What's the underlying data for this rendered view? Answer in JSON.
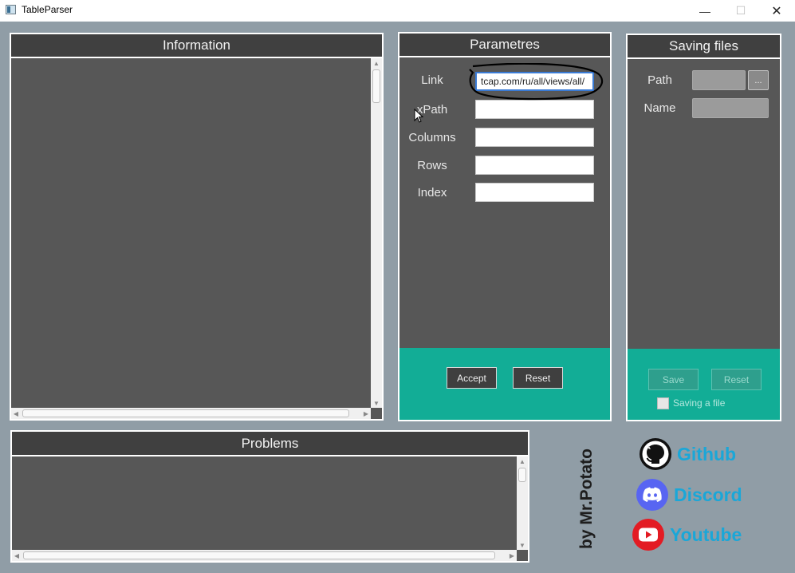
{
  "window": {
    "title": "TableParser",
    "controls": {
      "minimize": "—",
      "maximize": "☐",
      "close": "✕"
    }
  },
  "information": {
    "header": "Information"
  },
  "problems": {
    "header": "Problems"
  },
  "parameters": {
    "header": "Parametres",
    "fields": [
      {
        "label": "Link",
        "value": "tcap.com/ru/all/views/all/"
      },
      {
        "label": "xPath",
        "value": ""
      },
      {
        "label": "Columns",
        "value": ""
      },
      {
        "label": "Rows",
        "value": ""
      },
      {
        "label": "Index",
        "value": ""
      }
    ],
    "accept_label": "Accept",
    "reset_label": "Reset"
  },
  "saving": {
    "header": "Saving files",
    "path_label": "Path",
    "browse_label": "...",
    "name_label": "Name",
    "save_label": "Save",
    "reset_label": "Reset",
    "checkbox_label": "Saving a file",
    "checkbox_checked": false
  },
  "credit": "by Mr.Potato",
  "links": [
    {
      "label": "Github",
      "icon": "github-icon"
    },
    {
      "label": "Discord",
      "icon": "discord-icon"
    },
    {
      "label": "Youtube",
      "icon": "youtube-icon"
    }
  ],
  "colors": {
    "background": "#909da6",
    "panel": "#575757",
    "header": "#404040",
    "teal": "#12ad96",
    "link": "#1aa7d8",
    "discord": "#5865f2",
    "youtube": "#e31b23"
  }
}
